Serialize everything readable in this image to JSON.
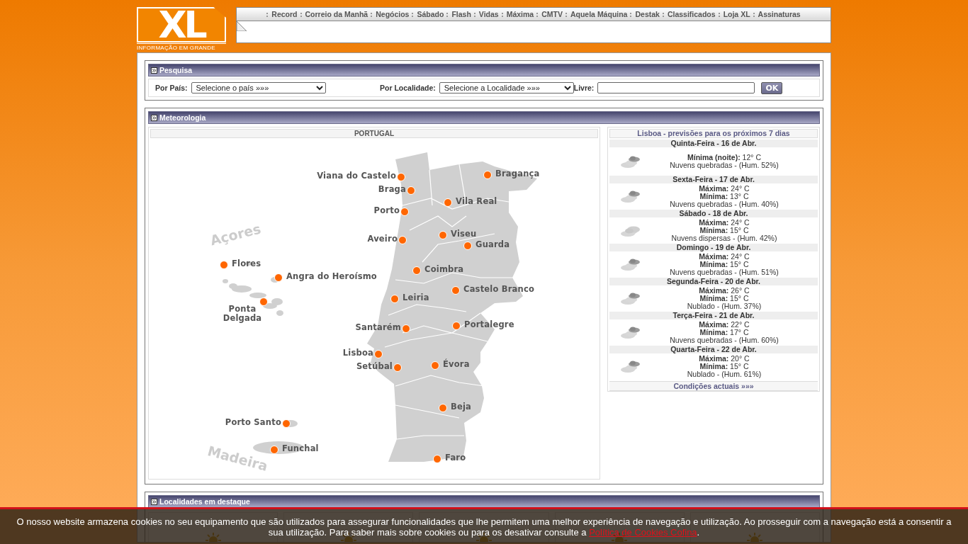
{
  "logo": {
    "text": "XL",
    "tagline": "INFORMAÇÃO EM GRANDE"
  },
  "nav": [
    "Record",
    "Correio da Manhã",
    "Negócios",
    "Sábado",
    "Flash",
    "Vidas",
    "Máxima",
    "CMTV",
    "Aquela Máquina",
    "Destak",
    "Classificados",
    "Loja XL",
    "Assinaturas"
  ],
  "search": {
    "title": "Pesquisa",
    "fields": [
      {
        "kind": "select",
        "label": "Por País:",
        "value": "Selecione o país »»»"
      },
      {
        "kind": "select",
        "label": "Por Localidade:",
        "value": "Selecione a Localidade »»»"
      },
      {
        "kind": "text",
        "label": "Livre:"
      }
    ],
    "button": "OK"
  },
  "weather": {
    "title": "Meteorologia",
    "map": {
      "title": "PORTUGAL",
      "regions": [
        "Açores",
        "Madeira"
      ],
      "cities": [
        "Viana do Castelo",
        "Braga",
        "Porto",
        "Vila Real",
        "Bragança",
        "Aveiro",
        "Viseu",
        "Guarda",
        "Coimbra",
        "Castelo Branco",
        "Leiria",
        "Santarém",
        "Portalegre",
        "Lisboa",
        "Setúbal",
        "Évora",
        "Beja",
        "Faro",
        "Flores",
        "Angra do Heroísmo",
        "Ponta Delgada",
        "Porto Santo",
        "Funchal"
      ]
    },
    "forecast": {
      "title": "Lisboa - previsões para os próximos 7 dias",
      "days": [
        {
          "day": "Quinta-Feira - 16 de Abr.",
          "kind": "broken",
          "lines": [
            {
              "label": "Mínima (noite):",
              "value": "12° C"
            }
          ],
          "desc": "Nuvens quebradas - (Hum. 52%)"
        },
        {
          "day": "Sexta-Feira - 17 de Abr.",
          "kind": "broken",
          "lines": [
            {
              "label": "Máxima:",
              "value": "24° C"
            },
            {
              "label": "Mínima:",
              "value": "13° C"
            }
          ],
          "desc": "Nuvens quebradas - (Hum. 40%)"
        },
        {
          "day": "Sábado - 18 de Abr.",
          "kind": "scattered",
          "lines": [
            {
              "label": "Máxima:",
              "value": "24° C"
            },
            {
              "label": "Mínima:",
              "value": "15° C"
            }
          ],
          "desc": "Nuvens dispersas - (Hum. 42%)"
        },
        {
          "day": "Domingo - 19 de Abr.",
          "kind": "broken",
          "lines": [
            {
              "label": "Máxima:",
              "value": "24° C"
            },
            {
              "label": "Mínima:",
              "value": "15° C"
            }
          ],
          "desc": "Nuvens quebradas - (Hum. 51%)"
        },
        {
          "day": "Segunda-Feira - 20 de Abr.",
          "kind": "broken",
          "lines": [
            {
              "label": "Máxima:",
              "value": "26° C"
            },
            {
              "label": "Mínima:",
              "value": "15° C"
            }
          ],
          "desc": "Nublado - (Hum. 37%)"
        },
        {
          "day": "Terça-Feira - 21 de Abr.",
          "kind": "broken",
          "lines": [
            {
              "label": "Máxima:",
              "value": "22° C"
            },
            {
              "label": "Mínima:",
              "value": "17° C"
            }
          ],
          "desc": "Nuvens quebradas - (Hum. 60%)"
        },
        {
          "day": "Quarta-Feira - 22 de Abr.",
          "kind": "broken",
          "lines": [
            {
              "label": "Máxima:",
              "value": "20° C"
            },
            {
              "label": "Mínima:",
              "value": "15° C"
            }
          ],
          "desc": "Nublado - (Hum. 61%)"
        }
      ],
      "footer": "Condições actuais »»»"
    }
  },
  "highlights": {
    "title": "Localidades em destaque"
  },
  "cookie": {
    "text": "O nosso website armazena cookies no seu equipamento que são utilizados para assegurar funcionalidades que lhe permitem uma melhor experiência de navegação e utilização. Ao prosseguir com a navegação está a consentir a sua utilização. Para saber mais sobre cookies ou para os desativar consulte a ",
    "link": "Política de Cookies Cofina",
    "end": "."
  }
}
